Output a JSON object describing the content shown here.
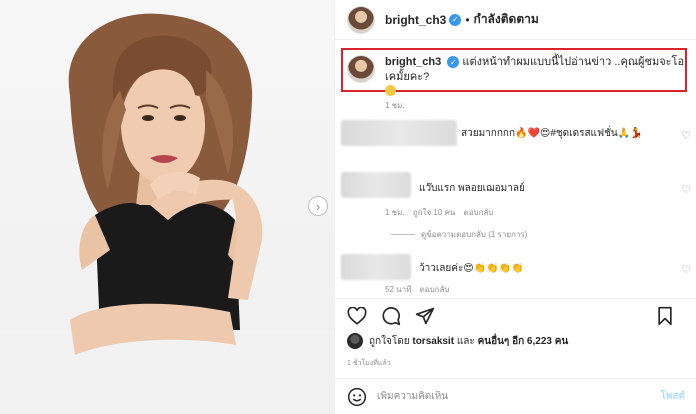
{
  "header": {
    "username": "bright_ch3",
    "separator": "•",
    "follow_status": "กำลังติดตาม"
  },
  "caption": {
    "username": "bright_ch3",
    "text": "แต่งหน้าทำผมแบบนี้ไปอ่านข่าว ..คุณผู้ชมจะโอเคมั้ยคะ?",
    "time": "1 ชม."
  },
  "comments": [
    {
      "text": "สวยมากกกก🔥❤️😍#ชุดเดรสแฟชั่น🙏💃",
      "meta": []
    },
    {
      "text": "แว๊บแรก พลอยเฌอมาลย์",
      "meta": [
        "1 ชม.",
        "ถูกใจ 10 คน",
        "ตอบกลับ"
      ],
      "replies": "ดูข้อความตอบกลับ (1 รายการ)"
    },
    {
      "text": "ว้าวเลยค่ะ😍👏👏👏👏",
      "meta": [
        "52 นาที",
        "ตอบกลับ"
      ]
    }
  ],
  "likes": {
    "prefix": "ถูกใจโดย",
    "user": "torsaksit",
    "and": "และ",
    "others": "คนอื่นๆ อีก 6,223 คน"
  },
  "posted_time": "1 ชั่วโมงที่แล้ว",
  "comment_input": {
    "placeholder": "เพิ่มความคิดเห็น",
    "post_label": "โพสต์"
  },
  "icons": {
    "verified": "verified-badge-icon",
    "like": "heart-icon",
    "comment": "comment-icon",
    "share": "paper-plane-icon",
    "save": "bookmark-icon",
    "emoji": "smiley-icon",
    "next": "chevron-right-icon"
  },
  "colors": {
    "highlight_box": "#d9232d",
    "verified": "#3897f0",
    "muted_text": "#8e8e8e",
    "post_button": "#b2dffc"
  }
}
